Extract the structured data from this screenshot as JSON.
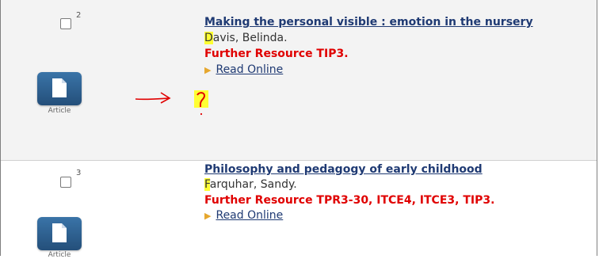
{
  "records": [
    {
      "number": "2",
      "format": "Article",
      "title": "Making the personal visible : emotion in the nursery",
      "author_initial": "D",
      "author_rest": "avis, Belinda.",
      "resource": "Further Resource TIP3.",
      "read_online": "Read Online"
    },
    {
      "number": "3",
      "format": "Article",
      "title": "Philosophy and pedagogy of early childhood",
      "author_initial": "F",
      "author_rest": "arquhar, Sandy.",
      "resource": "Further Resource TPR3-30, ITCE4, ITCE3, TIP3.",
      "read_online": "Read Online"
    }
  ],
  "annotation": {
    "arrow_color": "#e00000",
    "mark": "?",
    "highlight_color": "#ffff33"
  },
  "icons": [
    "document-icon",
    "triangle-bullet-icon",
    "arrow-annotation-icon"
  ]
}
